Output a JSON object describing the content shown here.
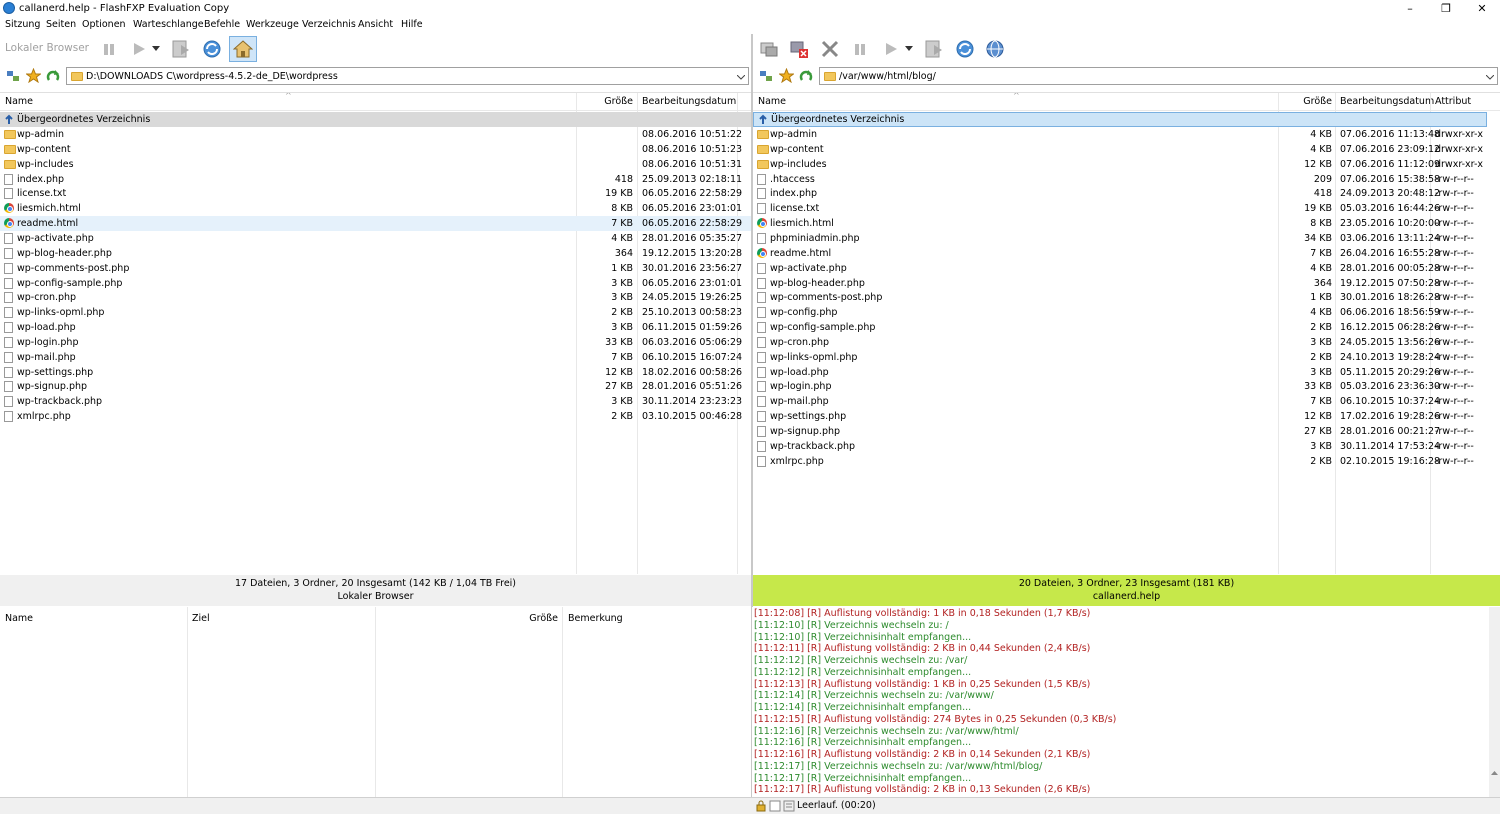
{
  "window": {
    "title": "callanerd.help - FlashFXP Evaluation Copy",
    "min": "–",
    "max": "❐",
    "close": "✕"
  },
  "menu": [
    "Sitzung",
    "Seiten",
    "Optionen",
    "Warteschlange",
    "Befehle",
    "Werkzeuge",
    "Verzeichnis",
    "Ansicht",
    "Hilfe"
  ],
  "left": {
    "toolbar_label": "Lokaler Browser",
    "path": "D:\\DOWNLOADS C\\wordpress-4.5.2-de_DE\\wordpress",
    "columns": {
      "name": "Name",
      "size": "Größe",
      "date": "Bearbeitungsdatum"
    },
    "parent": "Übergeordnetes Verzeichnis",
    "rows": [
      {
        "icon": "folder",
        "name": "wp-admin",
        "size": "",
        "date": "08.06.2016 10:51:22"
      },
      {
        "icon": "folder",
        "name": "wp-content",
        "size": "",
        "date": "08.06.2016 10:51:23"
      },
      {
        "icon": "folder",
        "name": "wp-includes",
        "size": "",
        "date": "08.06.2016 10:51:31"
      },
      {
        "icon": "file",
        "name": "index.php",
        "size": "418",
        "date": "25.09.2013 02:18:11"
      },
      {
        "icon": "file",
        "name": "license.txt",
        "size": "19 KB",
        "date": "06.05.2016 22:58:29"
      },
      {
        "icon": "chrome",
        "name": "liesmich.html",
        "size": "8 KB",
        "date": "06.05.2016 23:01:01"
      },
      {
        "icon": "chrome",
        "name": "readme.html",
        "size": "7 KB",
        "date": "06.05.2016 22:58:29"
      },
      {
        "icon": "file",
        "name": "wp-activate.php",
        "size": "4 KB",
        "date": "28.01.2016 05:35:27"
      },
      {
        "icon": "file",
        "name": "wp-blog-header.php",
        "size": "364",
        "date": "19.12.2015 13:20:28"
      },
      {
        "icon": "file",
        "name": "wp-comments-post.php",
        "size": "1 KB",
        "date": "30.01.2016 23:56:27"
      },
      {
        "icon": "file",
        "name": "wp-config-sample.php",
        "size": "3 KB",
        "date": "06.05.2016 23:01:01"
      },
      {
        "icon": "file",
        "name": "wp-cron.php",
        "size": "3 KB",
        "date": "24.05.2015 19:26:25"
      },
      {
        "icon": "file",
        "name": "wp-links-opml.php",
        "size": "2 KB",
        "date": "25.10.2013 00:58:23"
      },
      {
        "icon": "file",
        "name": "wp-load.php",
        "size": "3 KB",
        "date": "06.11.2015 01:59:26"
      },
      {
        "icon": "file",
        "name": "wp-login.php",
        "size": "33 KB",
        "date": "06.03.2016 05:06:29"
      },
      {
        "icon": "file",
        "name": "wp-mail.php",
        "size": "7 KB",
        "date": "06.10.2015 16:07:24"
      },
      {
        "icon": "file",
        "name": "wp-settings.php",
        "size": "12 KB",
        "date": "18.02.2016 00:58:26"
      },
      {
        "icon": "file",
        "name": "wp-signup.php",
        "size": "27 KB",
        "date": "28.01.2016 05:51:26"
      },
      {
        "icon": "file",
        "name": "wp-trackback.php",
        "size": "3 KB",
        "date": "30.11.2014 23:23:23"
      },
      {
        "icon": "file",
        "name": "xmlrpc.php",
        "size": "2 KB",
        "date": "03.10.2015 00:46:28"
      }
    ],
    "status_line1": "17 Dateien, 3 Ordner, 20 Insgesamt (142 KB / 1,04 TB Frei)",
    "status_line2": "Lokaler Browser"
  },
  "right": {
    "path": "/var/www/html/blog/",
    "columns": {
      "name": "Name",
      "size": "Größe",
      "date": "Bearbeitungsdatum",
      "attr": "Attribut"
    },
    "parent": "Übergeordnetes Verzeichnis",
    "rows": [
      {
        "icon": "folder",
        "name": "wp-admin",
        "size": "4 KB",
        "date": "07.06.2016 11:13:48",
        "attr": "drwxr-xr-x"
      },
      {
        "icon": "folder",
        "name": "wp-content",
        "size": "4 KB",
        "date": "07.06.2016 23:09:12",
        "attr": "drwxr-xr-x"
      },
      {
        "icon": "folder",
        "name": "wp-includes",
        "size": "12 KB",
        "date": "07.06.2016 11:12:09",
        "attr": "drwxr-xr-x"
      },
      {
        "icon": "file",
        "name": ".htaccess",
        "size": "209",
        "date": "07.06.2016 15:38:58",
        "attr": "-rw-r--r--"
      },
      {
        "icon": "file",
        "name": "index.php",
        "size": "418",
        "date": "24.09.2013 20:48:12",
        "attr": "-rw-r--r--"
      },
      {
        "icon": "file",
        "name": "license.txt",
        "size": "19 KB",
        "date": "05.03.2016 16:44:26",
        "attr": "-rw-r--r--"
      },
      {
        "icon": "chrome",
        "name": "liesmich.html",
        "size": "8 KB",
        "date": "23.05.2016 10:20:00",
        "attr": "-rw-r--r--"
      },
      {
        "icon": "file",
        "name": "phpminiadmin.php",
        "size": "34 KB",
        "date": "03.06.2016 13:11:24",
        "attr": "-rw-r--r--"
      },
      {
        "icon": "chrome",
        "name": "readme.html",
        "size": "7 KB",
        "date": "26.04.2016 16:55:28",
        "attr": "-rw-r--r--"
      },
      {
        "icon": "file",
        "name": "wp-activate.php",
        "size": "4 KB",
        "date": "28.01.2016 00:05:28",
        "attr": "-rw-r--r--"
      },
      {
        "icon": "file",
        "name": "wp-blog-header.php",
        "size": "364",
        "date": "19.12.2015 07:50:28",
        "attr": "-rw-r--r--"
      },
      {
        "icon": "file",
        "name": "wp-comments-post.php",
        "size": "1 KB",
        "date": "30.01.2016 18:26:28",
        "attr": "-rw-r--r--"
      },
      {
        "icon": "file",
        "name": "wp-config.php",
        "size": "4 KB",
        "date": "06.06.2016 18:56:59",
        "attr": "-rw-r--r--"
      },
      {
        "icon": "file",
        "name": "wp-config-sample.php",
        "size": "2 KB",
        "date": "16.12.2015 06:28:26",
        "attr": "-rw-r--r--"
      },
      {
        "icon": "file",
        "name": "wp-cron.php",
        "size": "3 KB",
        "date": "24.05.2015 13:56:26",
        "attr": "-rw-r--r--"
      },
      {
        "icon": "file",
        "name": "wp-links-opml.php",
        "size": "2 KB",
        "date": "24.10.2013 19:28:24",
        "attr": "-rw-r--r--"
      },
      {
        "icon": "file",
        "name": "wp-load.php",
        "size": "3 KB",
        "date": "05.11.2015 20:29:26",
        "attr": "-rw-r--r--"
      },
      {
        "icon": "file",
        "name": "wp-login.php",
        "size": "33 KB",
        "date": "05.03.2016 23:36:30",
        "attr": "-rw-r--r--"
      },
      {
        "icon": "file",
        "name": "wp-mail.php",
        "size": "7 KB",
        "date": "06.10.2015 10:37:24",
        "attr": "-rw-r--r--"
      },
      {
        "icon": "file",
        "name": "wp-settings.php",
        "size": "12 KB",
        "date": "17.02.2016 19:28:26",
        "attr": "-rw-r--r--"
      },
      {
        "icon": "file",
        "name": "wp-signup.php",
        "size": "27 KB",
        "date": "28.01.2016 00:21:27",
        "attr": "-rw-r--r--"
      },
      {
        "icon": "file",
        "name": "wp-trackback.php",
        "size": "3 KB",
        "date": "30.11.2014 17:53:24",
        "attr": "-rw-r--r--"
      },
      {
        "icon": "file",
        "name": "xmlrpc.php",
        "size": "2 KB",
        "date": "02.10.2015 19:16:28",
        "attr": "-rw-r--r--"
      }
    ],
    "status_line1": "20 Dateien, 3 Ordner, 23 Insgesamt (181 KB)",
    "status_line2": "callanerd.help",
    "status_color": "#c6e84a"
  },
  "queue": {
    "columns": {
      "name": "Name",
      "target": "Ziel",
      "size": "Größe",
      "remark": "Bemerkung"
    }
  },
  "log": [
    {
      "c": "#b22222",
      "t": "[11:12:08]  [R] Auflistung vollständig: 1 KB in 0,18 Sekunden (1,7 KB/s)"
    },
    {
      "c": "#2e8b2e",
      "t": "[11:12:10]  [R] Verzeichnis wechseln zu: /"
    },
    {
      "c": "#2e8b2e",
      "t": "[11:12:10]  [R] Verzeichnisinhalt empfangen..."
    },
    {
      "c": "#b22222",
      "t": "[11:12:11]  [R] Auflistung vollständig: 2 KB in 0,44 Sekunden (2,4 KB/s)"
    },
    {
      "c": "#2e8b2e",
      "t": "[11:12:12]  [R] Verzeichnis wechseln zu: /var/"
    },
    {
      "c": "#2e8b2e",
      "t": "[11:12:12]  [R] Verzeichnisinhalt empfangen..."
    },
    {
      "c": "#b22222",
      "t": "[11:12:13]  [R] Auflistung vollständig: 1 KB in 0,25 Sekunden (1,5 KB/s)"
    },
    {
      "c": "#2e8b2e",
      "t": "[11:12:14]  [R] Verzeichnis wechseln zu: /var/www/"
    },
    {
      "c": "#2e8b2e",
      "t": "[11:12:14]  [R] Verzeichnisinhalt empfangen..."
    },
    {
      "c": "#b22222",
      "t": "[11:12:15]  [R] Auflistung vollständig: 274 Bytes in 0,25 Sekunden (0,3 KB/s)"
    },
    {
      "c": "#2e8b2e",
      "t": "[11:12:16]  [R] Verzeichnis wechseln zu: /var/www/html/"
    },
    {
      "c": "#2e8b2e",
      "t": "[11:12:16]  [R] Verzeichnisinhalt empfangen..."
    },
    {
      "c": "#b22222",
      "t": "[11:12:16]  [R] Auflistung vollständig: 2 KB in 0,14 Sekunden (2,1 KB/s)"
    },
    {
      "c": "#2e8b2e",
      "t": "[11:12:17]  [R] Verzeichnis wechseln zu: /var/www/html/blog/"
    },
    {
      "c": "#2e8b2e",
      "t": "[11:12:17]  [R] Verzeichnisinhalt empfangen..."
    },
    {
      "c": "#b22222",
      "t": "[11:12:17]  [R] Auflistung vollständig: 2 KB in 0,13 Sekunden (2,6 KB/s)"
    }
  ],
  "bottom_status": "Leerlauf. (00:20)"
}
